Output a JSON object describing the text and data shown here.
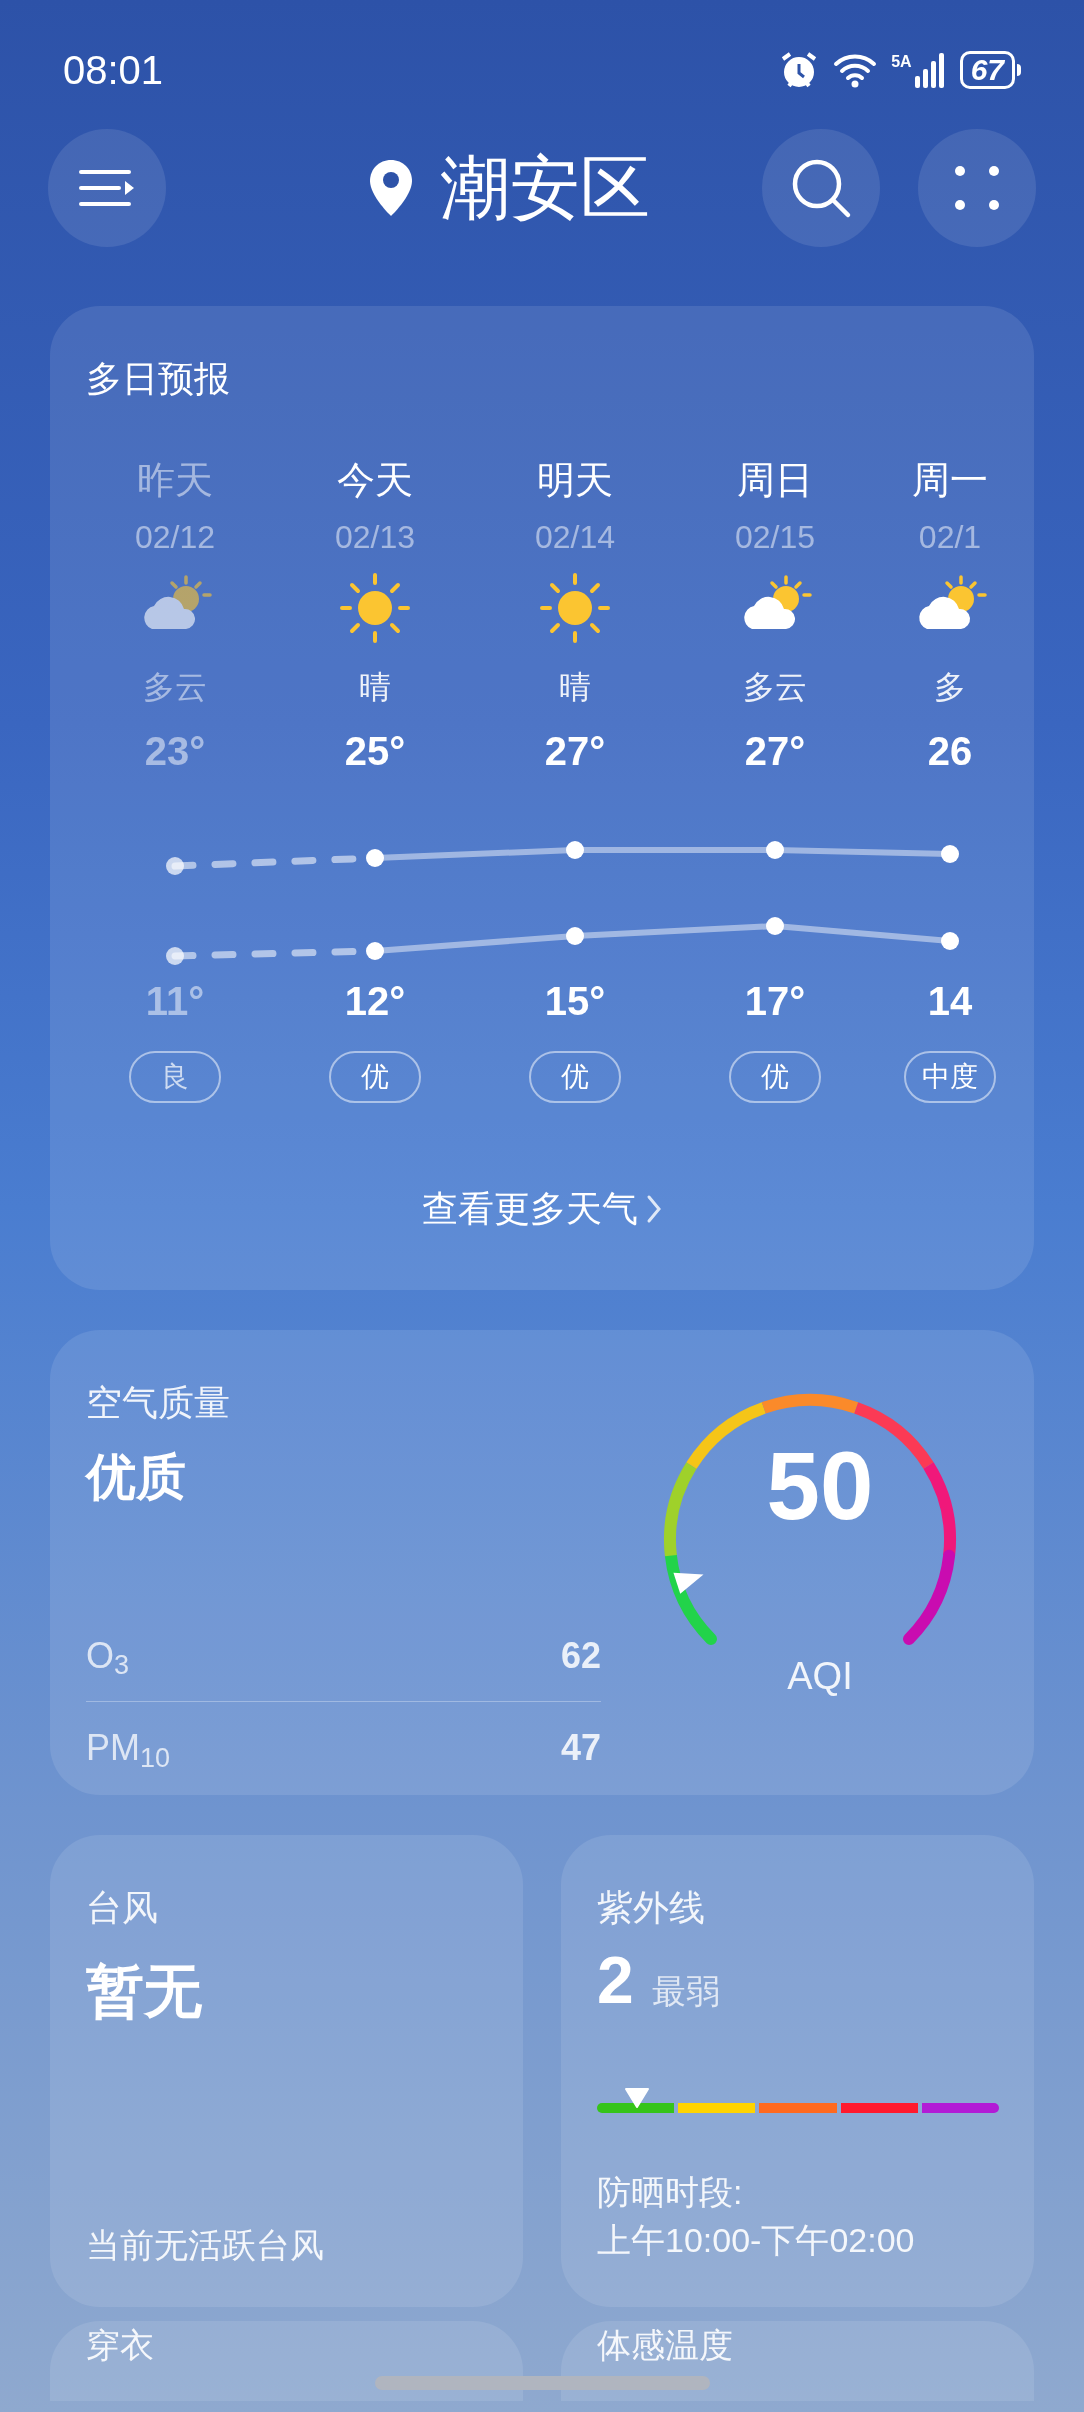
{
  "status_bar": {
    "time": "08:01",
    "network": "5A",
    "battery": "67"
  },
  "header": {
    "location": "潮安区"
  },
  "forecast": {
    "title": "多日预报",
    "days": [
      {
        "day": "昨天",
        "date": "02/12",
        "kind": "partly_cloudy",
        "condition": "多云",
        "high": "23°",
        "low": "11°",
        "air": "良",
        "past": true
      },
      {
        "day": "今天",
        "date": "02/13",
        "kind": "sunny",
        "condition": "晴",
        "high": "25°",
        "low": "12°",
        "air": "优",
        "past": false
      },
      {
        "day": "明天",
        "date": "02/14",
        "kind": "sunny",
        "condition": "晴",
        "high": "27°",
        "low": "15°",
        "air": "优",
        "past": false
      },
      {
        "day": "周日",
        "date": "02/15",
        "kind": "partly_cloudy",
        "condition": "多云",
        "high": "27°",
        "low": "17°",
        "air": "优",
        "past": false
      },
      {
        "day": "周一",
        "date": "02/1",
        "kind": "partly_cloudy",
        "condition": "多",
        "high": "26",
        "low": "14",
        "air": "中度",
        "past": false
      }
    ],
    "more_link": "查看更多天气"
  },
  "air_quality": {
    "title": "空气质量",
    "grade": "优质",
    "pollutants": [
      {
        "name": "O",
        "sub": "3",
        "value": "62"
      },
      {
        "name": "PM",
        "sub": "10",
        "value": "47"
      }
    ],
    "aqi": "50",
    "aqi_label": "AQI",
    "level": 0.1
  },
  "typhoon": {
    "title": "台风",
    "value": "暂无",
    "note": "当前无活跃台风"
  },
  "uv": {
    "title": "紫外线",
    "index": "2",
    "grade": "最弱",
    "level": 0.1,
    "protect_label": "防晒时段:",
    "protect_time": "上午10:00-下午02:00"
  },
  "more_cards": [
    "穿衣",
    "体感温度"
  ]
}
